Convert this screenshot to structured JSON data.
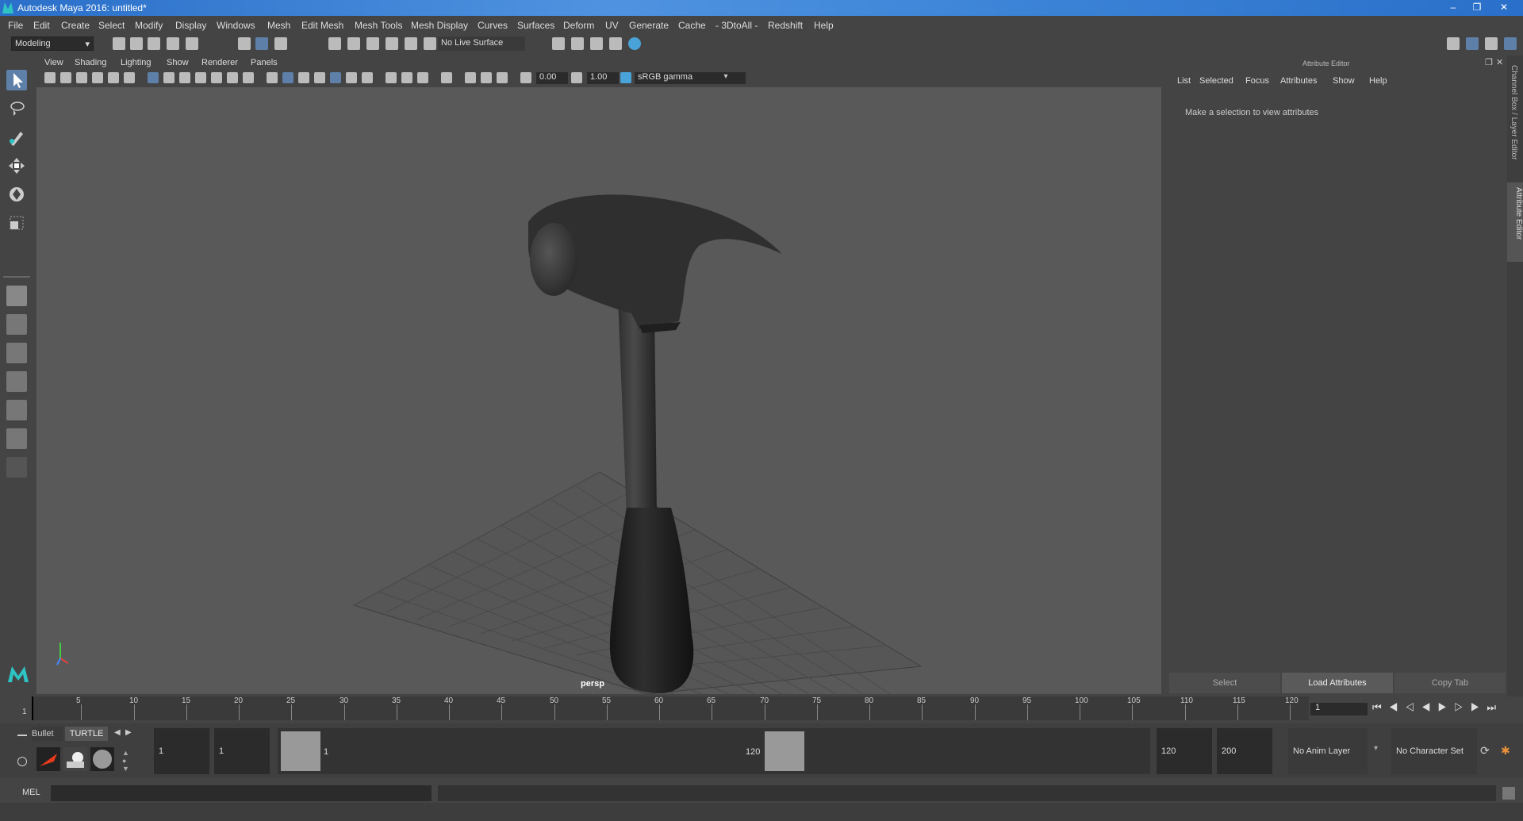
{
  "window": {
    "title": "Autodesk Maya 2016: untitled*"
  },
  "menubar": [
    "File",
    "Edit",
    "Create",
    "Select",
    "Modify",
    "Display",
    "Windows",
    "Mesh",
    "Edit Mesh",
    "Mesh Tools",
    "Mesh Display",
    "Curves",
    "Surfaces",
    "Deform",
    "UV",
    "Generate",
    "Cache",
    "- 3DtoAll -",
    "Redshift",
    "Help"
  ],
  "toolbar": {
    "mode": "Modeling",
    "live_surface": "No Live Surface"
  },
  "viewport": {
    "menu": [
      "View",
      "Shading",
      "Lighting",
      "Show",
      "Renderer",
      "Panels"
    ],
    "exposure": "0.00",
    "gamma": "1.00",
    "color_space": "sRGB gamma",
    "camera_label": "persp"
  },
  "attribute_editor": {
    "title": "Attribute Editor",
    "menu": [
      "List",
      "Selected",
      "Focus",
      "Attributes",
      "Show",
      "Help"
    ],
    "message": "Make a selection to view attributes",
    "buttons": {
      "select": "Select",
      "load": "Load Attributes",
      "copy": "Copy Tab"
    }
  },
  "side_tabs": {
    "channel_box": "Channel Box / Layer Editor",
    "attribute_editor": "Attribute Editor"
  },
  "timeline": {
    "start_marker": "1",
    "ticks": [
      5,
      10,
      15,
      20,
      25,
      30,
      35,
      40,
      45,
      50,
      55,
      60,
      65,
      70,
      75,
      80,
      85,
      90,
      95,
      100,
      105,
      110,
      115,
      120
    ],
    "current_frame": "1"
  },
  "shelf": {
    "tab_bullet": "Bullet",
    "tab_turtle": "TURTLE"
  },
  "range": {
    "start": "1",
    "playback_start": "1",
    "slider_start": "1",
    "slider_end": "120",
    "playback_end": "120",
    "end": "200",
    "anim_layer": "No Anim Layer",
    "char_set": "No Character Set"
  },
  "command": {
    "label": "MEL"
  }
}
